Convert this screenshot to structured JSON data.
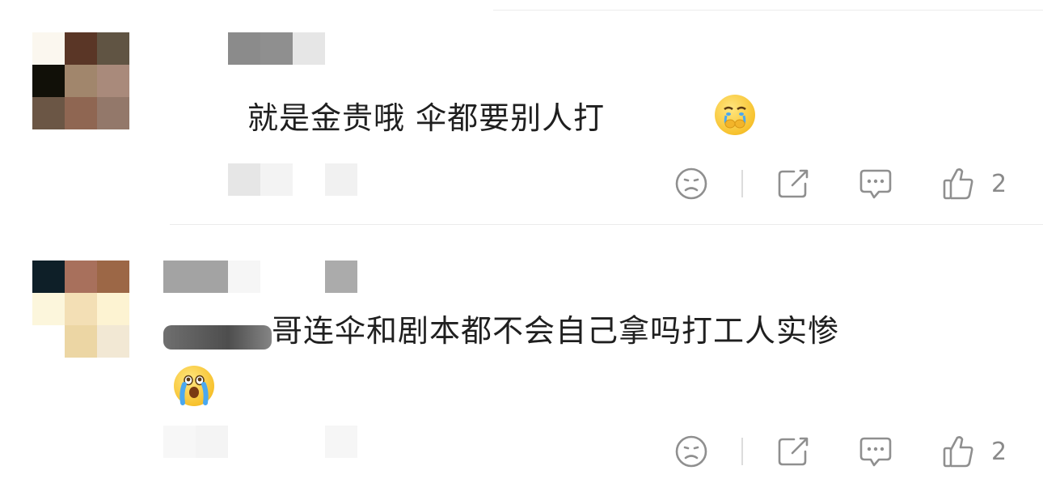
{
  "comments": [
    {
      "text": "就是金贵哦 伞都要别人打",
      "emoji_icon": "crying-covering-mouth-emoji",
      "actions": {
        "like_count": "2"
      }
    },
    {
      "text": "哥连伞和剧本都不会自己拿吗打工人实惨",
      "emoji_icon": "loudly-crying-emoji",
      "actions": {
        "like_count": "2"
      }
    }
  ],
  "icons": [
    "dislike-face-icon",
    "share-icon",
    "reply-comment-icon",
    "thumbs-up-icon"
  ],
  "colors": {
    "text": "#1f1f1f",
    "icon_gray": "#8f8f8f",
    "divider": "#ececec"
  }
}
